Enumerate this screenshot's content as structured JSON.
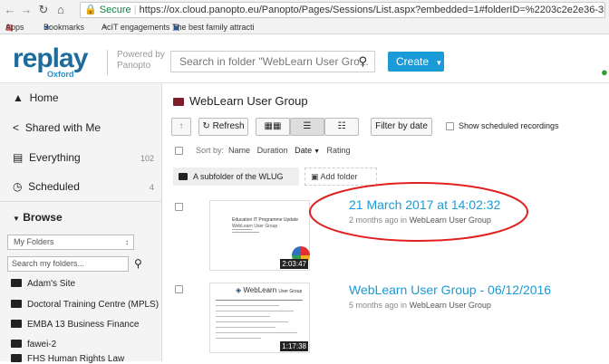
{
  "browser": {
    "lock_label": "Secure",
    "url": "https://ox.cloud.panopto.eu/Panopto/Pages/Sessions/List.aspx?embedded=1#folderID=%2203c2e2e36-35e0-479",
    "bookmarks": [
      "Apps",
      "Bookmarks",
      "AcIT engagements",
      "The best family attracti"
    ]
  },
  "header": {
    "logo": "replay",
    "logo_sub": "Oxford",
    "powered_line1": "Powered by",
    "powered_line2": "Panopto",
    "search_placeholder": "Search in folder \"WebLearn User Gro...",
    "create_label": "Create"
  },
  "sidebar": {
    "items": [
      {
        "label": "Home",
        "count": ""
      },
      {
        "label": "Shared with Me",
        "count": ""
      },
      {
        "label": "Everything",
        "count": "102"
      },
      {
        "label": "Scheduled",
        "count": "4"
      }
    ],
    "browse_label": "Browse",
    "folder_select": "My Folders",
    "folder_search_placeholder": "Search my folders...",
    "folders": [
      "Adam's Site",
      "Doctoral Training Centre (MPLS)",
      "EMBA 13 Business Finance",
      "fawei-2",
      "FHS Human Rights Law"
    ]
  },
  "main": {
    "folder_title": "WebLearn User Group",
    "refresh_label": "Refresh",
    "filter_label": "Filter by date",
    "scheduled_label": "Show scheduled recordings",
    "sort_by": "Sort by:",
    "sort_options": [
      "Name",
      "Duration",
      "Date",
      "Rating"
    ],
    "subfolder": "A subfolder of the WLUG",
    "add_folder": "Add folder",
    "sessions": [
      {
        "title": "21 March 2017 at 14:02:32",
        "meta_time": "2 months ago in",
        "meta_folder": "WebLearn User Group",
        "duration": "2:03:47",
        "thumb_title": "Education IT Programme Update",
        "thumb_sub": "WebLearn User Group"
      },
      {
        "title": "WebLearn User Group - 06/12/2016",
        "meta_time": "5 months ago in",
        "meta_folder": "WebLearn User Group",
        "duration": "1:17:38",
        "thumb_title": "WebLearn",
        "thumb_sub": "User Group"
      }
    ]
  },
  "colors": {
    "accent": "#1a9bd7",
    "brand": "#1e6b9e",
    "annotation": "#e02020"
  }
}
